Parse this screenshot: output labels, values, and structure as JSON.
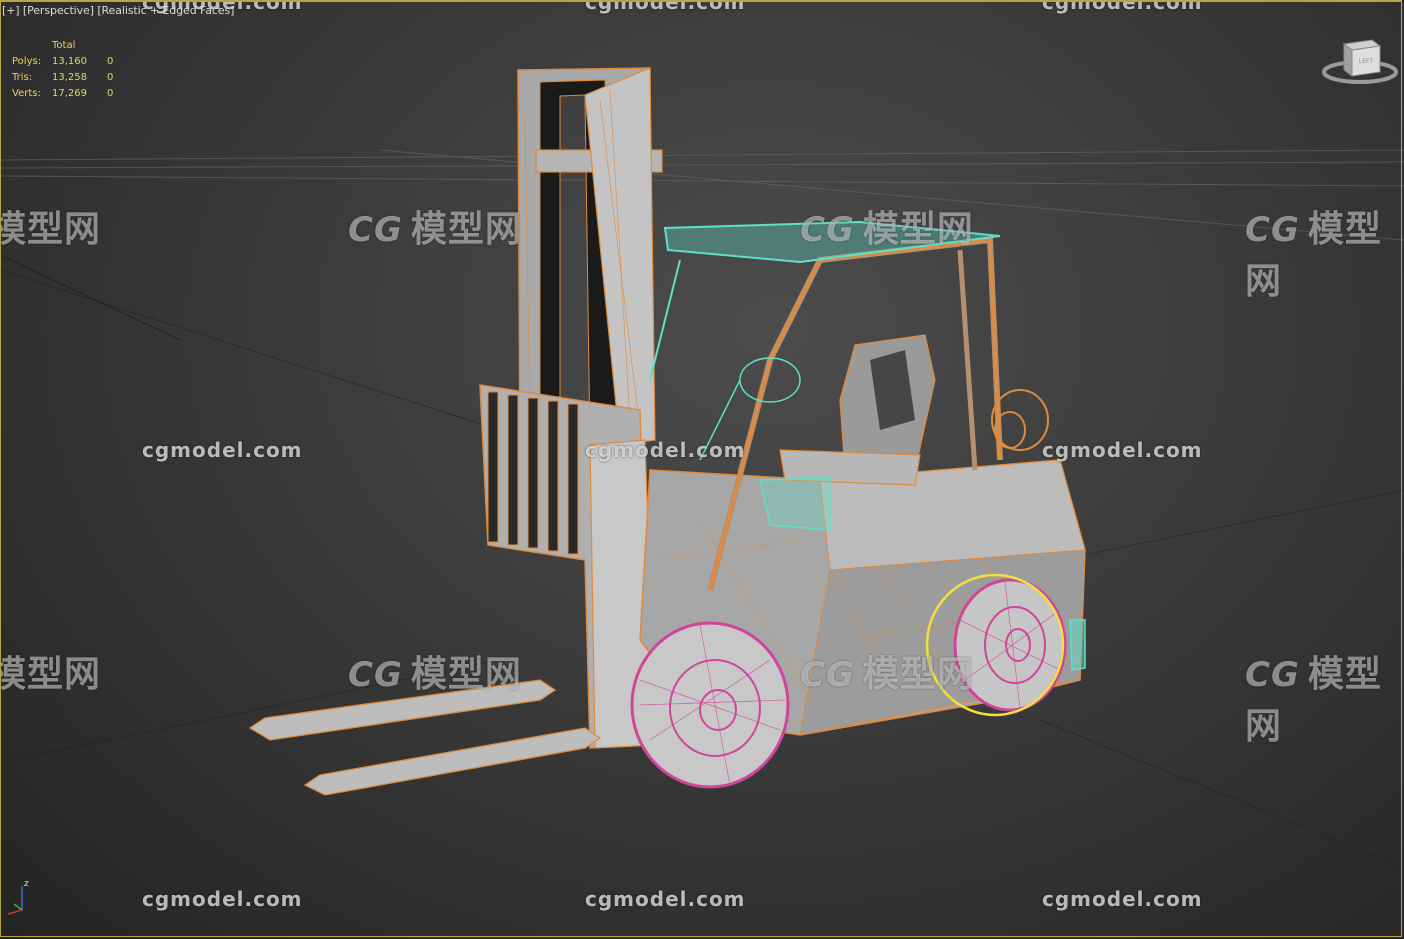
{
  "viewport": {
    "label_parts": [
      "[+]",
      "[Perspective]",
      "[Realistic + Edged Faces]"
    ],
    "border_color": "#b8a642"
  },
  "stats": {
    "header": "Total",
    "rows": [
      {
        "label": "Polys:",
        "total": "13,160",
        "selected": "0"
      },
      {
        "label": "Tris:",
        "total": "13,258",
        "selected": "0"
      },
      {
        "label": "Verts:",
        "total": "17,269",
        "selected": "0"
      }
    ],
    "text_color": "#e6d36a"
  },
  "viewcube": {
    "face_label": "LEFT"
  },
  "axis": {
    "z_label": "z"
  },
  "watermarks": {
    "cn_logo": "CG",
    "cn_text": "模型网",
    "en_text": "cgmodel.com"
  },
  "colors": {
    "wire_orange": "#e08a3c",
    "wire_cyan": "#5fe0c6",
    "wire_pink": "#d0449a",
    "selection_yellow": "#f0e040",
    "surface_gray": "#a8a8a8"
  }
}
